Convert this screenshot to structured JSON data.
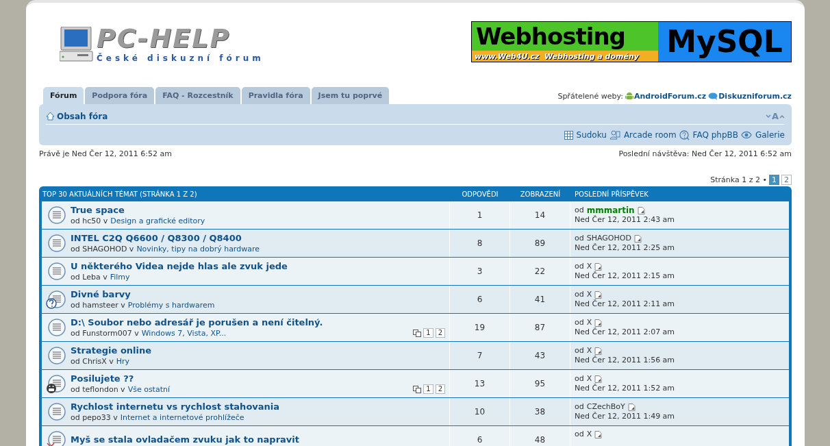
{
  "logo": {
    "title": "PC-HELP",
    "subtitle": "České diskuzní fórum"
  },
  "banner": {
    "headline": "Webhosting",
    "tagline": "www.Web4U.cz  Webhosting a domény",
    "product": "MySQL"
  },
  "tabs": [
    {
      "label": "Fórum",
      "selected": true
    },
    {
      "label": "Podpora fóra",
      "selected": false
    },
    {
      "label": "FAQ - Rozcestník",
      "selected": false
    },
    {
      "label": "Pravidla fóra",
      "selected": false
    },
    {
      "label": "Jsem tu poprvé",
      "selected": false
    }
  ],
  "friends": {
    "label": "Spřátelené weby:",
    "links": [
      {
        "label": "AndroidForum.cz",
        "kind": "android"
      },
      {
        "label": "Diskuzniforum.cz",
        "kind": "bubble"
      }
    ]
  },
  "navbar": {
    "breadcrumb": "Obsah fóra",
    "font_control": "A",
    "links": [
      {
        "label": "Sudoku",
        "kind": "grid"
      },
      {
        "label": "Arcade room",
        "kind": "person"
      },
      {
        "label": "FAQ phpBB",
        "kind": "help"
      },
      {
        "label": "Galerie",
        "kind": "eye"
      }
    ]
  },
  "current_time": "Právě je Ned Čer 12, 2011 6:52 am",
  "last_visit": "Poslední návštěva: Ned Čer 12, 2011 6:52 am",
  "pagination": {
    "label": "Stránka 1 z 2 •",
    "pages": [
      {
        "label": "1",
        "selected": true
      },
      {
        "label": "2",
        "selected": false
      }
    ]
  },
  "table": {
    "columns": [
      "TOP 30 AKTUÁLNÍCH TÉMAT (STRÁNKA 1 Z 2)",
      "ODPOVĚDI",
      "ZOBRAZENÍ",
      "POSLEDNÍ PŘÍSPĚVEK"
    ],
    "rows": [
      {
        "title": "True space",
        "by": "od hc50 v",
        "forum": "Design a grafické editory",
        "kind": "plain",
        "pages": [],
        "replies": "1",
        "views": "14",
        "last_by": "od",
        "last_author": "mmmartin",
        "color": "#008000",
        "last_time": "Ned Čer 12, 2011 2:43 am"
      },
      {
        "title": "INTEL C2Q Q6600 / Q8300 / Q8400",
        "by": "od SHAGOHOD v",
        "forum": "Novinky, tipy na dobrý hardware",
        "kind": "plain",
        "pages": [],
        "replies": "8",
        "views": "89",
        "last_by": "od",
        "last_author": "SHAGOHOD",
        "last_time": "Ned Čer 12, 2011 2:25 am"
      },
      {
        "title": "U některého Videa nejde hlas ale zvuk jede",
        "by": "od Leba v",
        "forum": "Filmy",
        "kind": "plain",
        "pages": [],
        "replies": "3",
        "views": "22",
        "last_by": "od",
        "last_author": "X",
        "last_time": "Ned Čer 12, 2011 2:15 am"
      },
      {
        "title": "Divné barvy",
        "by": "od hamsteer v",
        "forum": "Problémy s hardwarem",
        "kind": "question",
        "pages": [],
        "replies": "6",
        "views": "41",
        "last_by": "od",
        "last_author": "X",
        "last_time": "Ned Čer 12, 2011 2:11 am"
      },
      {
        "title": "D:\\ Soubor nebo adresář je porušen a není čitelný.",
        "by": "od Funstorm007 v",
        "forum": "Windows 7, Vista, XP...",
        "kind": "plain",
        "pages": [
          "1",
          "2"
        ],
        "replies": "19",
        "views": "87",
        "last_by": "od",
        "last_author": "X",
        "last_time": "Ned Čer 12, 2011 2:07 am"
      },
      {
        "title": "Strategie online",
        "by": "od ChrisX v",
        "forum": "Hry",
        "kind": "plain",
        "pages": [],
        "replies": "7",
        "views": "43",
        "last_by": "od",
        "last_author": "X",
        "last_time": "Ned Čer 12, 2011 1:56 am"
      },
      {
        "title": "Posilujete ??",
        "by": "od teflondon v",
        "forum": "Vše ostatní",
        "kind": "smiley",
        "pages": [
          "1",
          "2"
        ],
        "replies": "13",
        "views": "95",
        "last_by": "od",
        "last_author": "X",
        "last_time": "Ned Čer 12, 2011 1:52 am"
      },
      {
        "title": "Rychlost internetu vs rychlost stahovania",
        "by": "od pepo33 v",
        "forum": "Internet a internetové prohlížeče",
        "kind": "plain",
        "pages": [],
        "replies": "10",
        "views": "38",
        "last_by": "od",
        "last_author": "CZechBoY",
        "last_time": "Ned Čer 12, 2011 1:49 am"
      },
      {
        "title": "Myš se stala ovladačem zvuku jak to napravit",
        "kind": "tool",
        "pages": [],
        "replies": "6",
        "views": "48",
        "last_by": "od",
        "last_author": "X"
      }
    ]
  }
}
